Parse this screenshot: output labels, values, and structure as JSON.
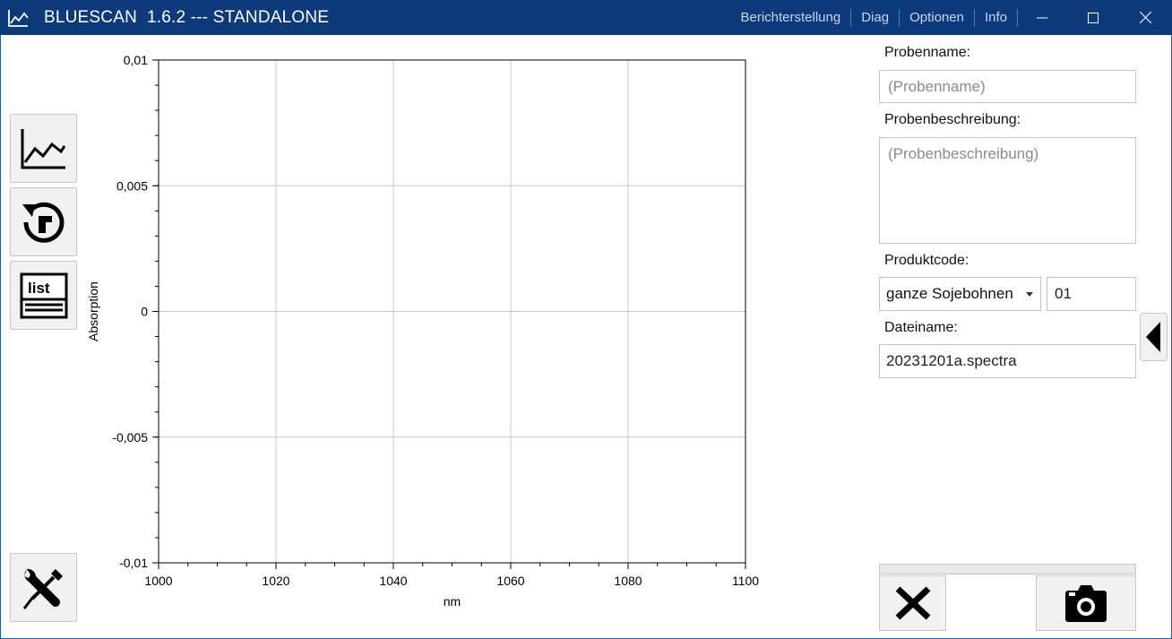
{
  "window": {
    "title": "BLUESCAN  1.6.2 --- STANDALONE",
    "menu": [
      "Berichterstellung",
      "Diag",
      "Optionen",
      "Info"
    ],
    "controls": [
      "minimize-icon",
      "maximize-icon",
      "close-icon"
    ]
  },
  "toolbar": {
    "buttons": [
      "chart-icon",
      "reset-icon",
      "list-icon",
      "tools-icon"
    ],
    "list_icon_text": "list"
  },
  "chart_data": {
    "type": "line",
    "series": [],
    "xlabel": "nm",
    "ylabel": "Absorption",
    "xlim": [
      1000,
      1100
    ],
    "ylim": [
      -0.01,
      0.01
    ],
    "x_ticks": [
      "1000",
      "1020",
      "1040",
      "1060",
      "1080",
      "1100"
    ],
    "y_ticks": [
      "0,01",
      "0,005",
      "0",
      "-0,005",
      "-0,01"
    ],
    "grid": true
  },
  "form": {
    "sample_name_label": "Probenname:",
    "sample_name_placeholder": "(Probenname)",
    "sample_name_value": "",
    "description_label": "Probenbeschreibung:",
    "description_placeholder": "(Probenbeschreibung)",
    "description_value": "",
    "product_code_label": "Produktcode:",
    "product_selected": "ganze Sojebohnen",
    "product_code_value": "01",
    "filename_label": "Dateiname:",
    "filename_value": "20231201a.spectra",
    "progress": 0
  },
  "actions": [
    "cancel-icon",
    "camera-icon",
    "collapse-panel-icon"
  ],
  "colors": {
    "titlebar": "#0d3a7a",
    "grid": "#c8c8c8",
    "button_bg": "#f1f1f1"
  }
}
